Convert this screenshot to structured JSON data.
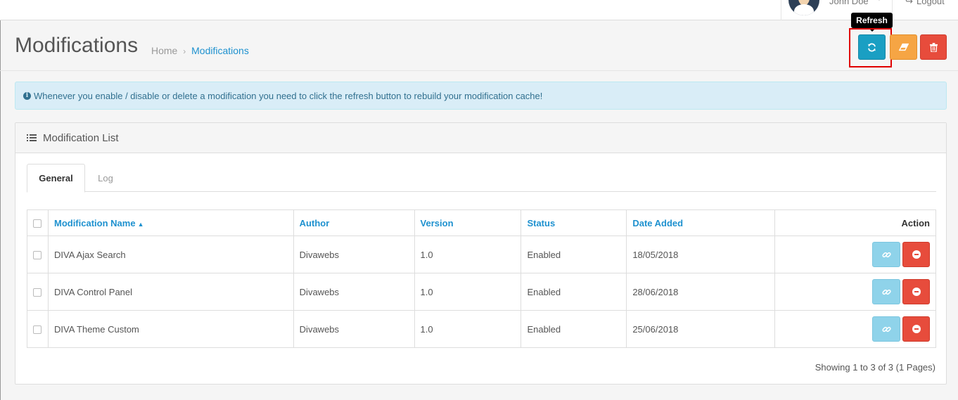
{
  "header": {
    "user_name": "John Doe",
    "logout_label": "Logout"
  },
  "page": {
    "title": "Modifications",
    "breadcrumb": [
      {
        "label": "Home"
      },
      {
        "label": "Modifications"
      }
    ]
  },
  "toolbar": {
    "refresh_tooltip": "Refresh",
    "refresh_icon": "refresh-icon",
    "clear_icon": "eraser-icon",
    "delete_icon": "trash-icon",
    "colors": {
      "refresh": "#1a9fc3",
      "clear": "#f6a544",
      "delete": "#e74c3c"
    }
  },
  "alert": {
    "text": "Whenever you enable / disable or delete a modification you need to click the refresh button to rebuild your modification cache!"
  },
  "panel": {
    "title": "Modification List",
    "tabs": [
      {
        "label": "General",
        "active": true
      },
      {
        "label": "Log",
        "active": false
      }
    ]
  },
  "table": {
    "columns": [
      "Modification Name",
      "Author",
      "Version",
      "Status",
      "Date Added",
      "Action"
    ],
    "rows": [
      {
        "name": "DIVA Ajax Search",
        "author": "Divawebs",
        "version": "1.0",
        "status": "Enabled",
        "date": "18/05/2018"
      },
      {
        "name": "DIVA Control Panel",
        "author": "Divawebs",
        "version": "1.0",
        "status": "Enabled",
        "date": "28/06/2018"
      },
      {
        "name": "DIVA Theme Custom",
        "author": "Divawebs",
        "version": "1.0",
        "status": "Enabled",
        "date": "25/06/2018"
      }
    ]
  },
  "pagination": {
    "info": "Showing 1 to 3 of 3 (1 Pages)"
  }
}
